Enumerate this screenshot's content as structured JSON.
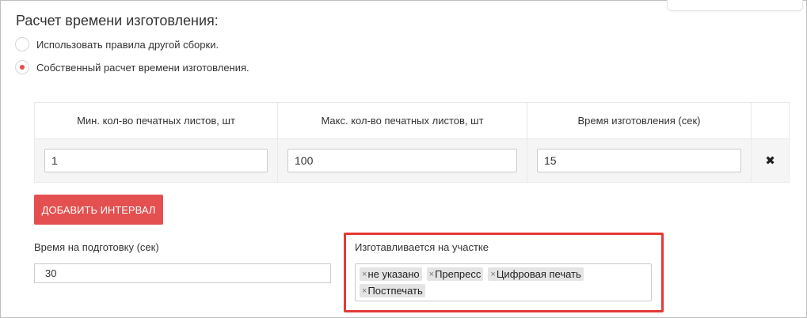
{
  "section": {
    "title": "Расчет времени изготовления:"
  },
  "radio_options": [
    {
      "label": "Использовать правила другой сборки.",
      "selected": false
    },
    {
      "label": "Собственный расчет времени изготовления.",
      "selected": true
    }
  ],
  "intervals_table": {
    "headers": [
      "Мин. кол-во печатных листов, шт",
      "Макс. кол-во печатных листов, шт",
      "Время изготовления (сек)"
    ],
    "rows": [
      {
        "min": "1",
        "max": "100",
        "time": "15"
      }
    ],
    "remove_icon": "close-icon"
  },
  "add_interval_button": "ДОБАВИТЬ ИНТЕРВАЛ",
  "prep_time": {
    "label": "Время на подготовку (сек)",
    "value": "30"
  },
  "production_area": {
    "label": "Изготавливается на участке",
    "tags": [
      "не указано",
      "Препресс",
      "Цифровая печать",
      "Постпечать"
    ],
    "highlight_color": "#e53935"
  },
  "colors": {
    "accent": "#e45050",
    "radio_selected": "#e84c4c"
  }
}
